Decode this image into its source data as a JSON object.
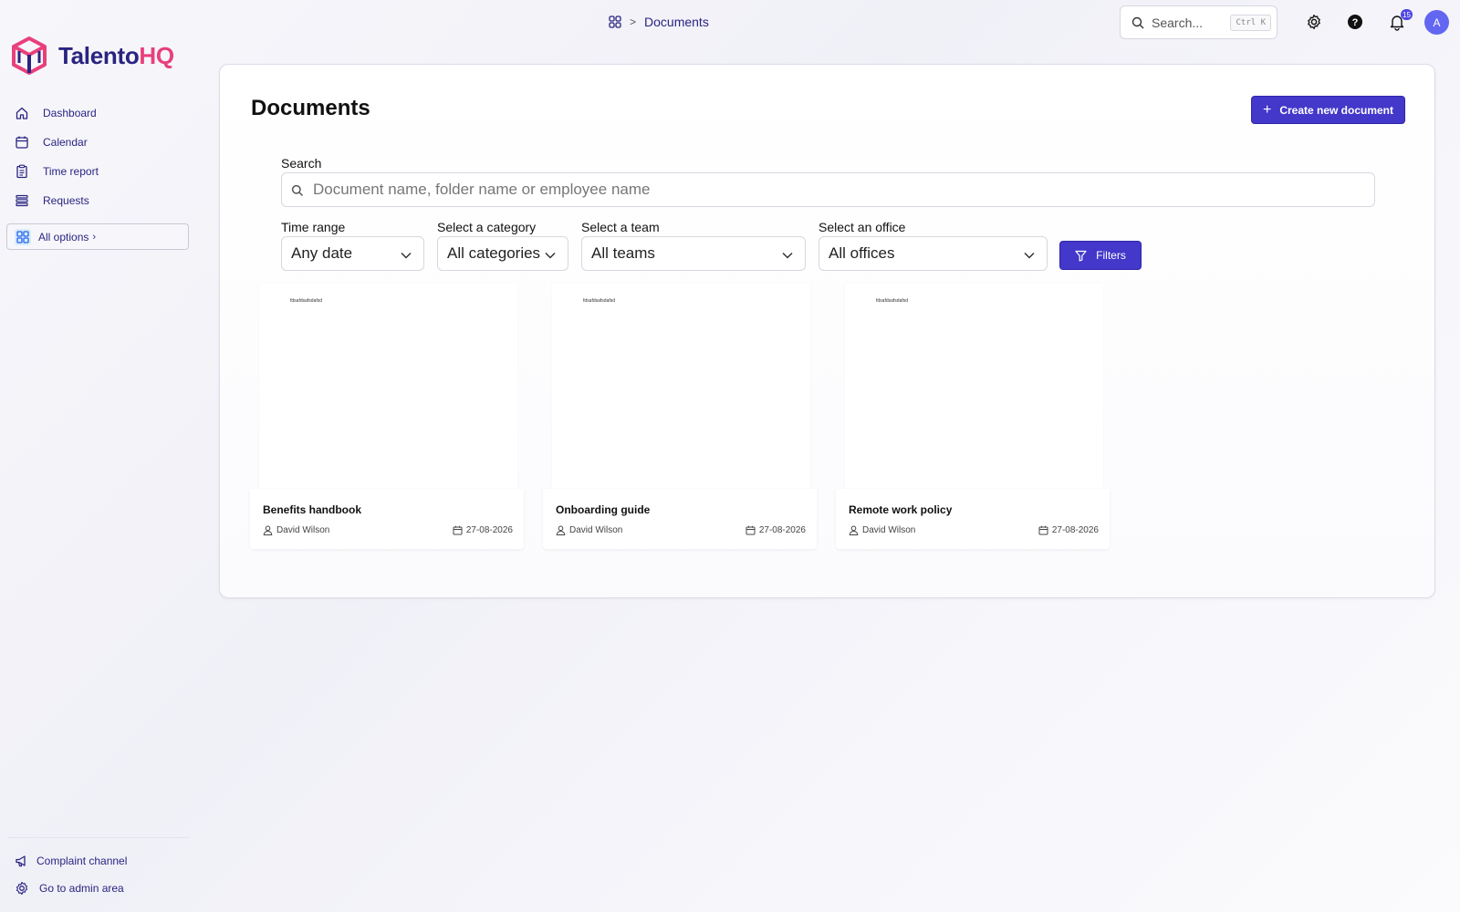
{
  "app": {
    "brand_part1": "Talento",
    "brand_part2": "HQ",
    "brand_colors": {
      "primary": "#2a2480",
      "accent": "#e8407a"
    }
  },
  "sidebar": {
    "items": [
      {
        "label": "Dashboard",
        "icon": "home-icon"
      },
      {
        "label": "Calendar",
        "icon": "calendar-icon"
      },
      {
        "label": "Time report",
        "icon": "clipboard-icon"
      },
      {
        "label": "Requests",
        "icon": "list-icon"
      }
    ],
    "all_options": "All options",
    "bottom": [
      {
        "label": "Complaint channel",
        "icon": "megaphone-icon"
      },
      {
        "label": "Go to admin area",
        "icon": "gear-icon"
      }
    ]
  },
  "topbar": {
    "breadcrumb_current": "Documents",
    "search_placeholder": "Search...",
    "search_shortcut": "Ctrl K",
    "notification_count": "15",
    "avatar_initial": "A"
  },
  "page": {
    "title": "Documents",
    "create_button": "Create new document",
    "search_label": "Search",
    "search_placeholder": "Document name, folder name or employee name",
    "filters": {
      "time_range": {
        "label": "Time range",
        "value": "Any date"
      },
      "category": {
        "label": "Select a category",
        "value": "All categories"
      },
      "team": {
        "label": "Select a team",
        "value": "All teams"
      },
      "office": {
        "label": "Select an office",
        "value": "All offices"
      },
      "button": "Filters"
    },
    "documents": [
      {
        "name": "Benefits handbook",
        "author": "David Wilson",
        "date": "27-08-2026",
        "preview_text": "fdsafdsafsdafsd"
      },
      {
        "name": "Onboarding guide",
        "author": "David Wilson",
        "date": "27-08-2026",
        "preview_text": "fdsafdsafsdafsd"
      },
      {
        "name": "Remote work policy",
        "author": "David Wilson",
        "date": "27-08-2026",
        "preview_text": "fdsafdsafsdafsd"
      }
    ],
    "accent_color": "#4338ca"
  }
}
